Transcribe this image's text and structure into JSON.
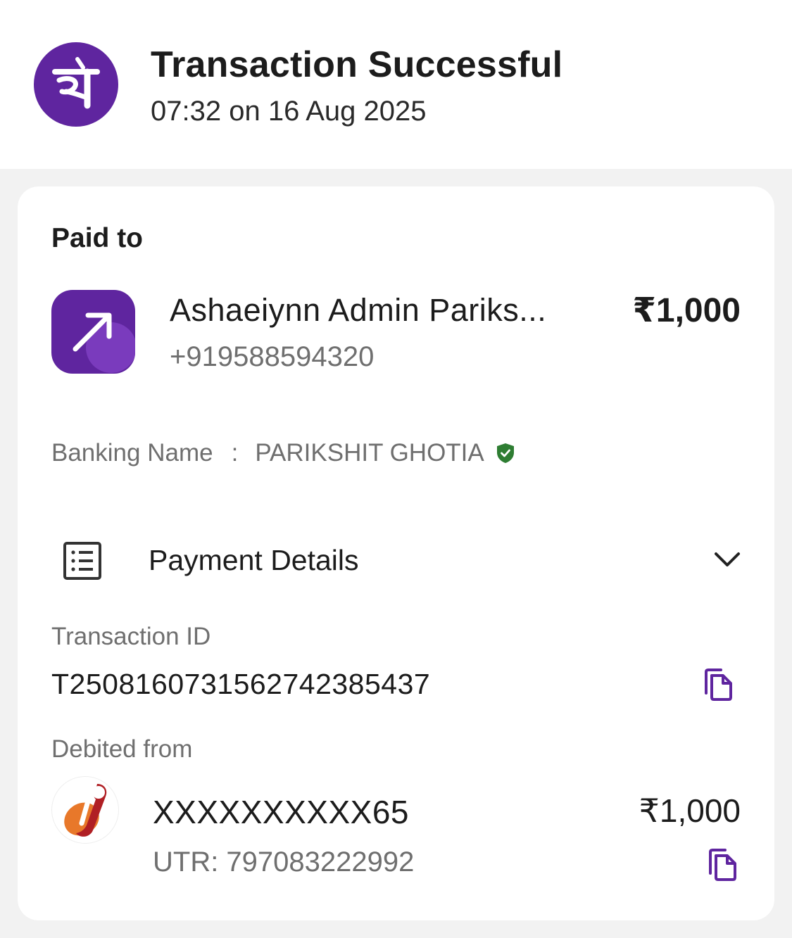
{
  "header": {
    "logo_icon": "phonepe-logo",
    "title": "Transaction Successful",
    "timestamp": "07:32 on 16 Aug 2025"
  },
  "paid_to": {
    "label": "Paid to",
    "icon": "arrow-up-right-icon",
    "name": "Ashaeiynn Admin Pariks...",
    "phone": "+919588594320",
    "amount": "₹1,000",
    "banking_name_label": "Banking Name",
    "banking_name_separator": ":",
    "banking_name_value": "PARIKSHIT GHOTIA",
    "verified_icon": "verified-shield-icon"
  },
  "payment_details": {
    "label": "Payment Details",
    "icon": "list-document-icon",
    "expand_icon": "chevron-down-icon",
    "transaction_id_label": "Transaction ID",
    "transaction_id": "T2508160731562742385437",
    "debited_from_label": "Debited from",
    "account_number": "XXXXXXXXXX65",
    "utr": "UTR: 797083222992",
    "debit_amount": "₹1,000",
    "bank_icon": "icici-bank-logo",
    "copy_icon": "copy-icon"
  },
  "colors": {
    "brand_purple": "#5f259f",
    "verified_green": "#2e7d32",
    "bank_orange": "#e8782a",
    "bank_red": "#b01f24"
  }
}
